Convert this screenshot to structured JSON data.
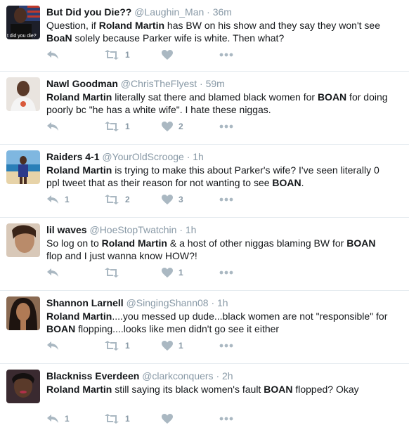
{
  "tweets": [
    {
      "name": "But Did you Die??",
      "handle": "@Laughin_Man",
      "time": "36m",
      "avatar_text": "t did you die?",
      "segments": [
        {
          "t": "Question, if "
        },
        {
          "t": "Roland Martin",
          "b": true
        },
        {
          "t": " has BW on his show and they say they won't see "
        },
        {
          "t": "BoaN",
          "b": true
        },
        {
          "t": " solely because Parker wife is white.  Then what?"
        }
      ],
      "retweets": "1",
      "likes": ""
    },
    {
      "name": "Nawl Goodman",
      "handle": "@ChrisTheFlyest",
      "time": "59m",
      "avatar_text": "",
      "segments": [
        {
          "t": "Roland Martin",
          "b": true
        },
        {
          "t": " literally sat there and blamed black women for "
        },
        {
          "t": "BOAN",
          "b": true
        },
        {
          "t": " for doing poorly bc \"he has a white wife\". I hate these niggas."
        }
      ],
      "retweets": "1",
      "likes": "2"
    },
    {
      "name": "Raiders 4-1",
      "handle": "@YourOldScrooge",
      "time": "1h",
      "avatar_text": "",
      "segments": [
        {
          "t": "Roland Martin",
          "b": true
        },
        {
          "t": " is trying to make this about Parker's wife? I've seen literally 0 ppl tweet that as their reason for not wanting to see "
        },
        {
          "t": "BOAN",
          "b": true
        },
        {
          "t": "."
        }
      ],
      "replies": "1",
      "retweets": "2",
      "likes": "3"
    },
    {
      "name": "lil waves",
      "handle": "@HoeStopTwatchin",
      "time": "1h",
      "avatar_text": "",
      "segments": [
        {
          "t": "So log on to "
        },
        {
          "t": "Roland Martin",
          "b": true
        },
        {
          "t": " & a host of other niggas blaming BW for "
        },
        {
          "t": "BOAN",
          "b": true
        },
        {
          "t": " flop and I just wanna know HOW?!"
        }
      ],
      "retweets": "",
      "likes": "1"
    },
    {
      "name": "Shannon Larnell",
      "handle": "@SingingShann08",
      "time": "1h",
      "avatar_text": "",
      "segments": [
        {
          "t": "Roland Martin",
          "b": true
        },
        {
          "t": "....you messed up dude...black women are not \"responsible\" for "
        },
        {
          "t": "BOAN",
          "b": true
        },
        {
          "t": " flopping....looks like men didn't go see it either"
        }
      ],
      "retweets": "1",
      "likes": "1"
    },
    {
      "name": "Blackniss Everdeen",
      "handle": "@clarkconquers",
      "time": "2h",
      "avatar_text": "",
      "segments": [
        {
          "t": "Roland Martin",
          "b": true
        },
        {
          "t": " still saying its black women's fault "
        },
        {
          "t": "BOAN",
          "b": true
        },
        {
          "t": " flopped? Okay"
        }
      ],
      "replies": "1",
      "retweets": "1",
      "likes": ""
    }
  ],
  "separator": "·",
  "icons": {
    "reply": "reply-icon",
    "retweet": "retweet-icon",
    "like": "heart-icon",
    "more": "more-dots-icon"
  },
  "colors": {
    "icon": "#aab8c2",
    "meta": "#8899a6",
    "divider": "#e6ecf0"
  }
}
